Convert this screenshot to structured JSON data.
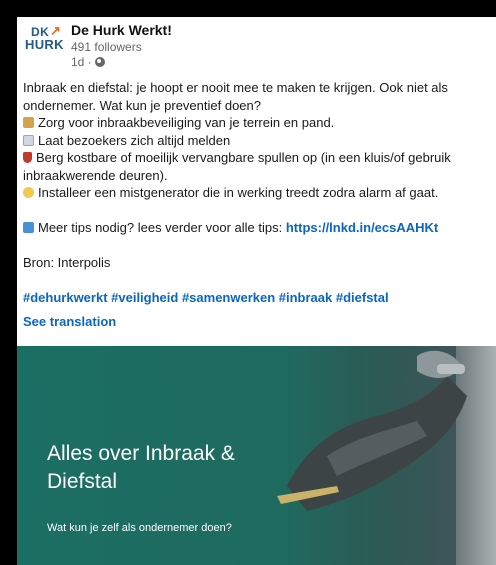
{
  "post": {
    "author": "De Hurk Werkt!",
    "followers": "491 followers",
    "time": "1d ·",
    "logo": {
      "line1": "DK",
      "line2": "HURK"
    },
    "lines": [
      "Inbraak en diefstal: je hoopt er nooit mee te maken te krijgen. Ook niet als",
      "ondernemer. Wat kun je preventief doen?",
      "Zorg voor inbraakbeveiliging van je terrein en pand.",
      "Laat bezoekers zich altijd melden",
      "Berg kostbare of moeilijk vervangbare spullen op (in een kluis/of gebruik inbraakwerende deuren).",
      "Installeer een mistgenerator die in werking treedt zodra alarm af gaat."
    ],
    "tips_text": "Meer tips nodig? lees verder voor alle tips: ",
    "tips_link": "https://lnkd.in/ecsAAHKt",
    "source": "Bron: Interpolis",
    "hashtags": "#dehurkwerkt #veiligheid #samenwerken #inbraak #diefstal",
    "see_translation": "See translation",
    "banner": {
      "title": "Alles over Inbraak & Diefstal",
      "subtitle": "Wat kun je zelf als ondernemer doen?"
    }
  },
  "colors": {
    "link": "#0a66c2",
    "banner": "#1b6e63"
  },
  "icons": [
    "lock-icon",
    "clipboard-icon",
    "shield-icon",
    "smile-icon",
    "arrow-right-icon",
    "globe-icon"
  ]
}
